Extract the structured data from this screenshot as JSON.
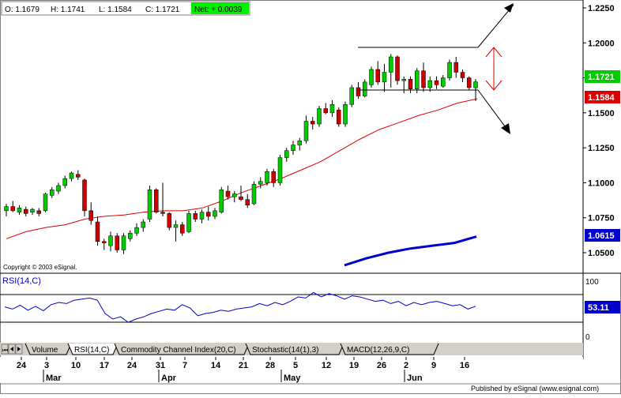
{
  "header": {
    "open": "O: 1.1679",
    "high": "H: 1.1741",
    "low": "L: 1.1584",
    "close": "C: 1.1721",
    "net": "Net: + 0.0039"
  },
  "colors": {
    "up_candle": "#00cc00",
    "down_candle": "#cc0000",
    "ma_red": "#dd0000",
    "ma_blue": "#0000cc",
    "rsi_line": "#0000cc",
    "net_bg": "#00ee00",
    "close_tag": "#00cc00",
    "low_tag": "#dd0000",
    "blue_tag": "#0000cc",
    "panel_bg": "#d4d0c8"
  },
  "price_axis": {
    "ticks": [
      "1.2250",
      "1.2000",
      "1.1750",
      "1.1500",
      "1.1250",
      "1.1000",
      "1.0750",
      "1.0500"
    ],
    "close_tag": "1.1721",
    "low_tag": "1.1584",
    "ma_tag": "1.0615"
  },
  "copyright": "Copyright © 2003 eSignal.",
  "rsi": {
    "label": "RSI(14,C)",
    "value_tag": "53.11",
    "ticks": [
      "100",
      "0"
    ]
  },
  "tabs": [
    "Volume",
    "RSI(14,C)",
    "Commodity Channel Index(20,C)",
    "Stochastic(14(1),3)",
    "MACD(12,26,9,C)"
  ],
  "x_axis": {
    "days": [
      "24",
      "3",
      "10",
      "17",
      "24",
      "31",
      "7",
      "14",
      "21",
      "28",
      "5",
      "12",
      "19",
      "26",
      "2",
      "9",
      "16"
    ],
    "months": [
      "Mar",
      "Apr",
      "May",
      "Jun"
    ]
  },
  "footer": "Published by eSignal (www.esignal.com)",
  "chart_data": {
    "type": "candlestick",
    "ylim": [
      1.04,
      1.23
    ],
    "candles": [
      {
        "o": 1.08,
        "h": 1.085,
        "l": 1.076,
        "c": 1.083
      },
      {
        "o": 1.083,
        "h": 1.087,
        "l": 1.079,
        "c": 1.08
      },
      {
        "o": 1.079,
        "h": 1.084,
        "l": 1.077,
        "c": 1.082
      },
      {
        "o": 1.081,
        "h": 1.083,
        "l": 1.076,
        "c": 1.078
      },
      {
        "o": 1.079,
        "h": 1.082,
        "l": 1.077,
        "c": 1.081
      },
      {
        "o": 1.08,
        "h": 1.082,
        "l": 1.076,
        "c": 1.078
      },
      {
        "o": 1.08,
        "h": 1.093,
        "l": 1.079,
        "c": 1.092
      },
      {
        "o": 1.091,
        "h": 1.097,
        "l": 1.089,
        "c": 1.095
      },
      {
        "o": 1.094,
        "h": 1.1,
        "l": 1.092,
        "c": 1.098
      },
      {
        "o": 1.098,
        "h": 1.105,
        "l": 1.096,
        "c": 1.103
      },
      {
        "o": 1.103,
        "h": 1.108,
        "l": 1.101,
        "c": 1.107
      },
      {
        "o": 1.106,
        "h": 1.109,
        "l": 1.102,
        "c": 1.104
      },
      {
        "o": 1.102,
        "h": 1.103,
        "l": 1.076,
        "c": 1.08
      },
      {
        "o": 1.08,
        "h": 1.086,
        "l": 1.07,
        "c": 1.073
      },
      {
        "o": 1.072,
        "h": 1.076,
        "l": 1.055,
        "c": 1.058
      },
      {
        "o": 1.058,
        "h": 1.06,
        "l": 1.052,
        "c": 1.057
      },
      {
        "o": 1.055,
        "h": 1.065,
        "l": 1.051,
        "c": 1.062
      },
      {
        "o": 1.062,
        "h": 1.064,
        "l": 1.05,
        "c": 1.052
      },
      {
        "o": 1.052,
        "h": 1.064,
        "l": 1.049,
        "c": 1.062
      },
      {
        "o": 1.06,
        "h": 1.066,
        "l": 1.058,
        "c": 1.064
      },
      {
        "o": 1.064,
        "h": 1.071,
        "l": 1.062,
        "c": 1.068
      },
      {
        "o": 1.068,
        "h": 1.074,
        "l": 1.065,
        "c": 1.072
      },
      {
        "o": 1.074,
        "h": 1.098,
        "l": 1.072,
        "c": 1.095
      },
      {
        "o": 1.095,
        "h": 1.096,
        "l": 1.078,
        "c": 1.079
      },
      {
        "o": 1.079,
        "h": 1.1,
        "l": 1.076,
        "c": 1.078
      },
      {
        "o": 1.078,
        "h": 1.079,
        "l": 1.066,
        "c": 1.068
      },
      {
        "o": 1.068,
        "h": 1.073,
        "l": 1.058,
        "c": 1.07
      },
      {
        "o": 1.07,
        "h": 1.072,
        "l": 1.062,
        "c": 1.064
      },
      {
        "o": 1.065,
        "h": 1.08,
        "l": 1.064,
        "c": 1.078
      },
      {
        "o": 1.078,
        "h": 1.08,
        "l": 1.072,
        "c": 1.074
      },
      {
        "o": 1.074,
        "h": 1.081,
        "l": 1.071,
        "c": 1.079
      },
      {
        "o": 1.079,
        "h": 1.083,
        "l": 1.073,
        "c": 1.076
      },
      {
        "o": 1.076,
        "h": 1.082,
        "l": 1.074,
        "c": 1.08
      },
      {
        "o": 1.079,
        "h": 1.097,
        "l": 1.078,
        "c": 1.095
      },
      {
        "o": 1.094,
        "h": 1.098,
        "l": 1.088,
        "c": 1.09
      },
      {
        "o": 1.09,
        "h": 1.094,
        "l": 1.086,
        "c": 1.092
      },
      {
        "o": 1.09,
        "h": 1.098,
        "l": 1.087,
        "c": 1.088
      },
      {
        "o": 1.088,
        "h": 1.092,
        "l": 1.082,
        "c": 1.084
      },
      {
        "o": 1.085,
        "h": 1.101,
        "l": 1.084,
        "c": 1.099
      },
      {
        "o": 1.099,
        "h": 1.104,
        "l": 1.096,
        "c": 1.101
      },
      {
        "o": 1.1,
        "h": 1.11,
        "l": 1.098,
        "c": 1.108
      },
      {
        "o": 1.108,
        "h": 1.11,
        "l": 1.097,
        "c": 1.1
      },
      {
        "o": 1.1,
        "h": 1.12,
        "l": 1.098,
        "c": 1.118
      },
      {
        "o": 1.118,
        "h": 1.125,
        "l": 1.115,
        "c": 1.123
      },
      {
        "o": 1.123,
        "h": 1.13,
        "l": 1.12,
        "c": 1.127
      },
      {
        "o": 1.127,
        "h": 1.132,
        "l": 1.123,
        "c": 1.13
      },
      {
        "o": 1.13,
        "h": 1.148,
        "l": 1.128,
        "c": 1.144
      },
      {
        "o": 1.144,
        "h": 1.147,
        "l": 1.138,
        "c": 1.142
      },
      {
        "o": 1.142,
        "h": 1.155,
        "l": 1.14,
        "c": 1.153
      },
      {
        "o": 1.153,
        "h": 1.157,
        "l": 1.149,
        "c": 1.15
      },
      {
        "o": 1.15,
        "h": 1.159,
        "l": 1.147,
        "c": 1.156
      },
      {
        "o": 1.152,
        "h": 1.154,
        "l": 1.14,
        "c": 1.142
      },
      {
        "o": 1.142,
        "h": 1.158,
        "l": 1.14,
        "c": 1.156
      },
      {
        "o": 1.156,
        "h": 1.17,
        "l": 1.154,
        "c": 1.168
      },
      {
        "o": 1.168,
        "h": 1.172,
        "l": 1.16,
        "c": 1.162
      },
      {
        "o": 1.162,
        "h": 1.174,
        "l": 1.161,
        "c": 1.172
      },
      {
        "o": 1.17,
        "h": 1.183,
        "l": 1.168,
        "c": 1.181
      },
      {
        "o": 1.181,
        "h": 1.187,
        "l": 1.17,
        "c": 1.172
      },
      {
        "o": 1.172,
        "h": 1.185,
        "l": 1.165,
        "c": 1.179
      },
      {
        "o": 1.179,
        "h": 1.192,
        "l": 1.168,
        "c": 1.19
      },
      {
        "o": 1.19,
        "h": 1.191,
        "l": 1.17,
        "c": 1.173
      },
      {
        "o": 1.173,
        "h": 1.176,
        "l": 1.164,
        "c": 1.174
      },
      {
        "o": 1.174,
        "h": 1.176,
        "l": 1.164,
        "c": 1.167
      },
      {
        "o": 1.167,
        "h": 1.182,
        "l": 1.164,
        "c": 1.18
      },
      {
        "o": 1.18,
        "h": 1.186,
        "l": 1.165,
        "c": 1.168
      },
      {
        "o": 1.168,
        "h": 1.176,
        "l": 1.165,
        "c": 1.173
      },
      {
        "o": 1.173,
        "h": 1.176,
        "l": 1.167,
        "c": 1.17
      },
      {
        "o": 1.169,
        "h": 1.177,
        "l": 1.168,
        "c": 1.175
      },
      {
        "o": 1.175,
        "h": 1.188,
        "l": 1.173,
        "c": 1.186
      },
      {
        "o": 1.186,
        "h": 1.19,
        "l": 1.175,
        "c": 1.179
      },
      {
        "o": 1.179,
        "h": 1.181,
        "l": 1.172,
        "c": 1.175
      },
      {
        "o": 1.175,
        "h": 1.176,
        "l": 1.166,
        "c": 1.168
      },
      {
        "o": 1.1679,
        "h": 1.1741,
        "l": 1.1584,
        "c": 1.1721
      }
    ],
    "ma_red": [
      1.06,
      1.065,
      1.068,
      1.07,
      1.074,
      1.076,
      1.077,
      1.079,
      1.08,
      1.08,
      1.082,
      1.087,
      1.093,
      1.098,
      1.103,
      1.109,
      1.115,
      1.123,
      1.131,
      1.138,
      1.143,
      1.148,
      1.152,
      1.157,
      1.16
    ],
    "ma_blue": [
      1.041,
      1.046,
      1.05,
      1.053,
      1.055,
      1.057,
      1.0615
    ],
    "rsi_values": [
      52,
      48,
      55,
      46,
      53,
      45,
      56,
      60,
      58,
      64,
      66,
      68,
      64,
      40,
      30,
      34,
      24,
      30,
      34,
      40,
      44,
      48,
      46,
      56,
      50,
      36,
      40,
      42,
      46,
      44,
      48,
      50,
      52,
      58,
      54,
      60,
      56,
      62,
      70,
      68,
      78,
      70,
      76,
      72,
      66,
      72,
      70,
      66,
      62,
      64,
      58,
      62,
      54,
      60,
      56,
      60,
      62,
      58,
      54,
      56,
      48,
      53.11
    ]
  }
}
